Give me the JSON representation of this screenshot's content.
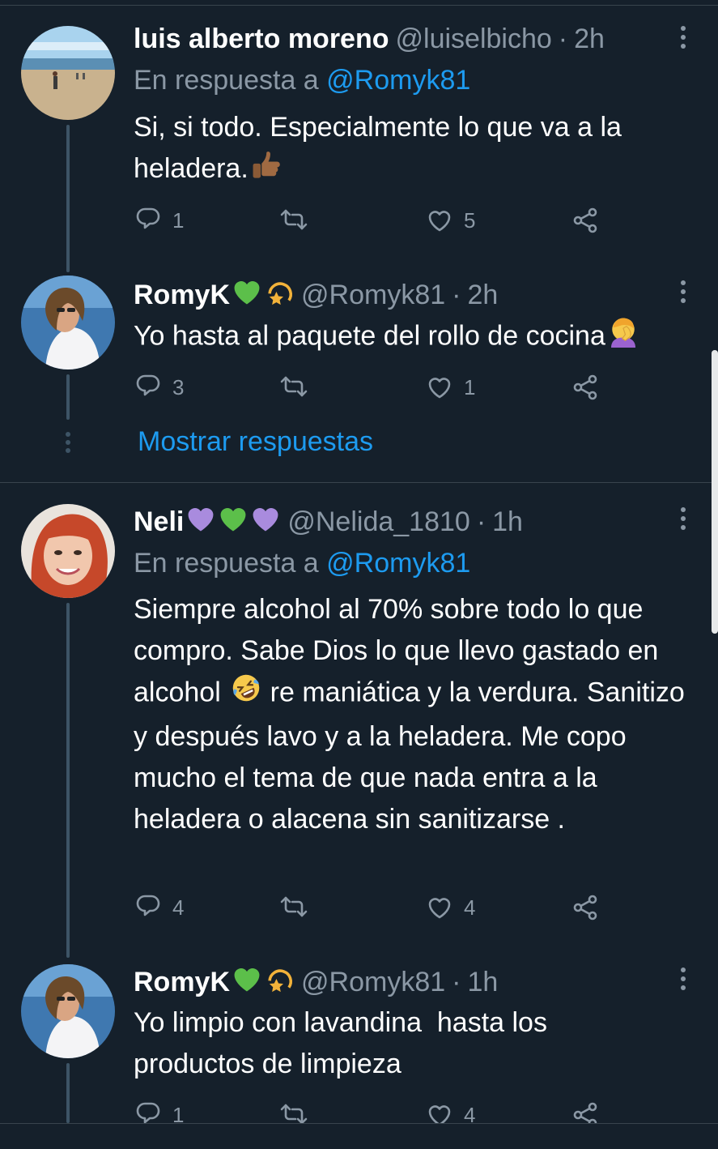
{
  "colors": {
    "background": "#15202b",
    "text": "#ffffff",
    "secondary": "#8b98a5",
    "accent": "#1d9bf0",
    "thread_line": "#3d5466"
  },
  "tweets": [
    {
      "name": "luis alberto moreno",
      "handle": "@luiselbicho",
      "sep": "·",
      "time": "2h",
      "reply_prefix": "En respuesta a",
      "reply_mention": "@Romyk81",
      "text": "Si, si todo. Especialmente lo que va a la heladera.",
      "text_emoji": "thumbs-up",
      "replies": "1",
      "retweets": "",
      "likes": "5"
    },
    {
      "name": "RomyK",
      "name_emojis": [
        "green-heart",
        "dizzy"
      ],
      "handle": "@Romyk81",
      "sep": "·",
      "time": "2h",
      "text": "Yo hasta al paquete del rollo de cocina",
      "text_emoji": "face-palm",
      "replies": "3",
      "retweets": "",
      "likes": "1",
      "show_replies": "Mostrar respuestas"
    },
    {
      "name": "Neli",
      "name_emojis": [
        "purple-heart",
        "green-heart",
        "purple-heart"
      ],
      "handle": "@Nelida_1810",
      "sep": "·",
      "time": "1h",
      "reply_prefix": "En respuesta a",
      "reply_mention": "@Romyk81",
      "text_part1": "Siempre alcohol al 70% sobre todo lo que compro. Sabe Dios lo que llevo gastado en alcohol",
      "text_emoji": "rolling-on-floor-laughing",
      "text_part2": "re maniática y la verdura. Sanitizo y después lavo y a la heladera. Me copo mucho el tema de que nada entra a la heladera o alacena sin sanitizarse .",
      "replies": "4",
      "retweets": "",
      "likes": "4"
    },
    {
      "name": "RomyK",
      "name_emojis": [
        "green-heart",
        "dizzy"
      ],
      "handle": "@Romyk81",
      "sep": "·",
      "time": "1h",
      "text": "Yo limpio con lavandina  hasta los productos de limpieza",
      "replies": "1",
      "retweets": "",
      "likes": "4"
    }
  ]
}
